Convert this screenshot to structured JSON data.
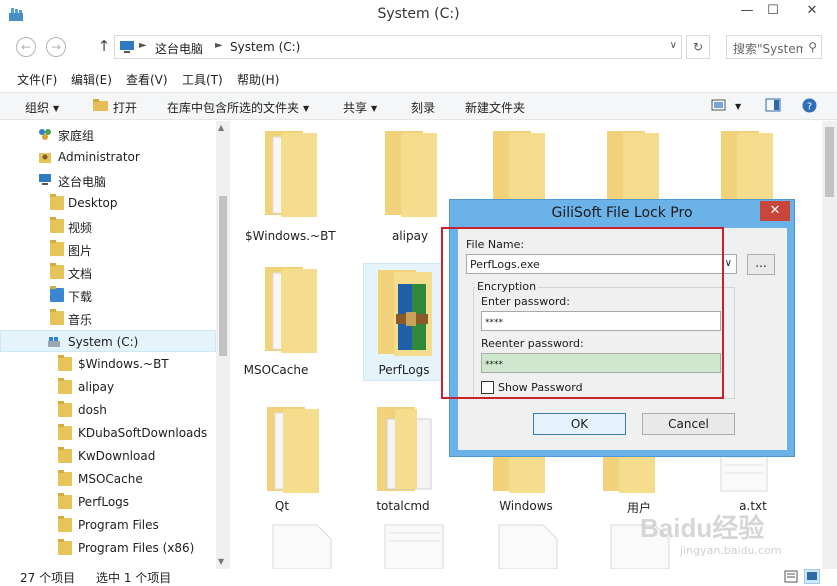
{
  "window": {
    "title": "System (C:)",
    "minimize": "—",
    "maximize": "☐",
    "close": "✕"
  },
  "address": {
    "crumbs": [
      "这台电脑",
      "System (C:)"
    ],
    "search_placeholder": "搜索\"System (C:)\""
  },
  "menu": [
    "文件(F)",
    "编辑(E)",
    "查看(V)",
    "工具(T)",
    "帮助(H)"
  ],
  "commands": {
    "organize": "组织",
    "open": "打开",
    "include_in_library": "在库中包含所选的文件夹",
    "share": "共享",
    "burn": "刻录",
    "new_folder": "新建文件夹"
  },
  "nav": {
    "items": [
      {
        "label": "家庭组",
        "icon": "homegroup-icon"
      },
      {
        "label": "Administrator",
        "icon": "user-folder-icon"
      },
      {
        "label": "这台电脑",
        "icon": "computer-icon"
      },
      {
        "label": "Desktop",
        "icon": "folder-icon"
      },
      {
        "label": "视频",
        "icon": "video-folder-icon"
      },
      {
        "label": "图片",
        "icon": "pictures-folder-icon"
      },
      {
        "label": "文档",
        "icon": "documents-folder-icon"
      },
      {
        "label": "下载",
        "icon": "downloads-folder-icon"
      },
      {
        "label": "音乐",
        "icon": "music-folder-icon"
      },
      {
        "label": "System (C:)",
        "icon": "drive-icon"
      },
      {
        "label": "$Windows.~BT",
        "icon": "folder-icon"
      },
      {
        "label": "alipay",
        "icon": "folder-icon"
      },
      {
        "label": "dosh",
        "icon": "folder-icon"
      },
      {
        "label": "KDubaSoftDownloads",
        "icon": "folder-icon"
      },
      {
        "label": "KwDownload",
        "icon": "folder-icon"
      },
      {
        "label": "MSOCache",
        "icon": "folder-icon"
      },
      {
        "label": "PerfLogs",
        "icon": "folder-icon"
      },
      {
        "label": "Program Files",
        "icon": "folder-icon"
      },
      {
        "label": "Program Files (x86)",
        "icon": "folder-icon"
      }
    ]
  },
  "files": {
    "row1": [
      "$Windows.~BT",
      "alipay"
    ],
    "row2": [
      "MSOCache",
      "PerfLogs"
    ],
    "row3": [
      "Qt",
      "totalcmd",
      "Windows",
      "用户",
      "a.txt"
    ]
  },
  "status": {
    "count": "27 个项目",
    "selected": "选中 1 个项目"
  },
  "dialog": {
    "title": "GiliSoft File Lock Pro",
    "file_name_label": "File Name:",
    "file_name_value": "PerfLogs.exe",
    "browse": "...",
    "encryption_label": "Encryption",
    "enter_password_label": "Enter password:",
    "enter_password_value": "****",
    "reenter_password_label": "Reenter password:",
    "reenter_password_value": "****",
    "show_password_label": "Show Password",
    "ok": "OK",
    "cancel": "Cancel"
  },
  "watermark": {
    "brand": "Baidu经验",
    "url": "jingyan.baidu.com"
  }
}
